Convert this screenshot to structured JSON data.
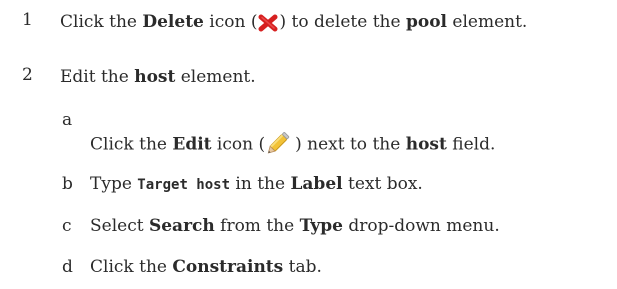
{
  "steps": [
    {
      "number": "1",
      "pre": "Click the ",
      "b1": "Delete",
      "mid1": " icon (",
      "mid2": ") to delete the ",
      "b2": "pool",
      "post": " element.",
      "icon": "delete-icon"
    },
    {
      "number": "2",
      "pre": "Edit the ",
      "b1": "host",
      "post": " element.",
      "substeps": [
        {
          "letter": "a",
          "pre": "Click the ",
          "b1": "Edit",
          "mid1": " icon (",
          "mid2": ") next to the ",
          "b2": "host",
          "post": " field.",
          "icon": "edit-pencil-icon"
        },
        {
          "letter": "b",
          "pre": "Type ",
          "code": "Target host",
          "mid": " in the ",
          "b1": "Label",
          "post": " text box."
        },
        {
          "letter": "c",
          "pre": "Select ",
          "b1": "Search",
          "mid": " from the ",
          "b2": "Type",
          "post": " drop-down menu."
        },
        {
          "letter": "d",
          "pre": "Click the ",
          "b1": "Constraints",
          "post": " tab."
        }
      ]
    }
  ],
  "colors": {
    "text": "#2b2b2b",
    "delete_icon": "#d62020",
    "pencil_body": "#f2c237",
    "pencil_tip": "#e9c9a0"
  }
}
